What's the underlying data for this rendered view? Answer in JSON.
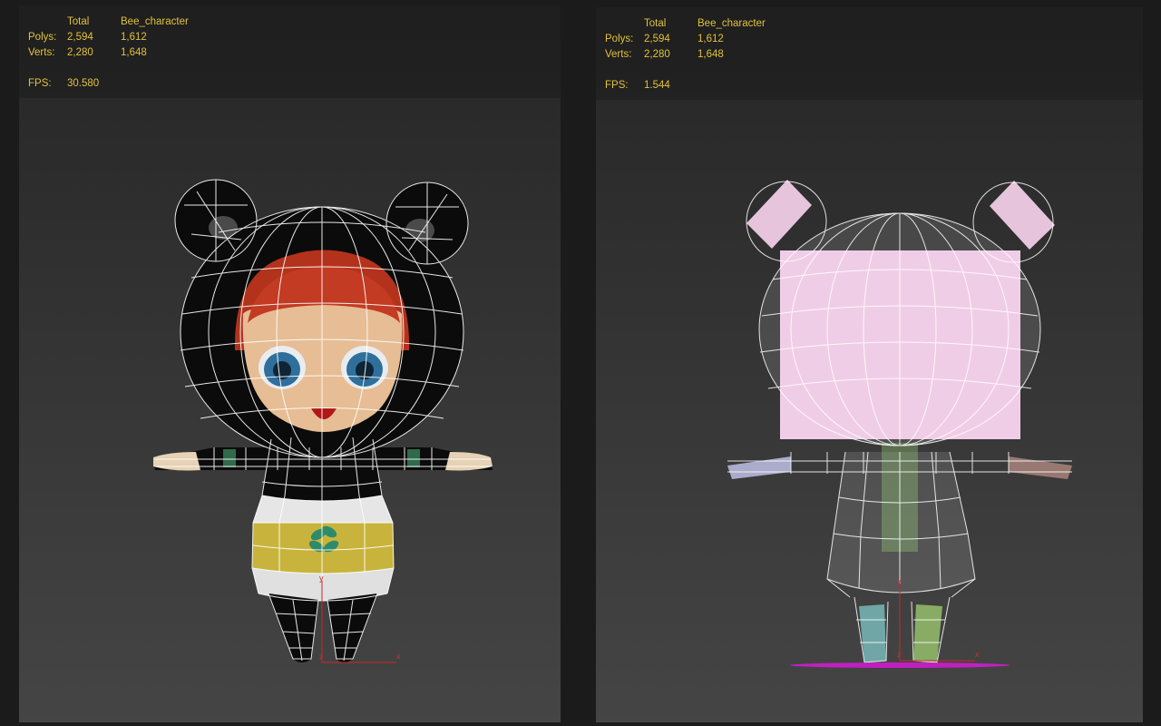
{
  "viewports": [
    {
      "stats": {
        "col_total": "Total",
        "col_object": "Bee_character",
        "polys_label": "Polys:",
        "polys_total": "2,594",
        "polys_object": "1,612",
        "verts_label": "Verts:",
        "verts_total": "2,280",
        "verts_object": "1,648",
        "fps_label": "FPS:",
        "fps_value": "30.580"
      },
      "axis": {
        "y": "y",
        "x": "x",
        "z": "z"
      }
    },
    {
      "stats": {
        "col_total": "Total",
        "col_object": "Bee_character",
        "polys_label": "Polys:",
        "polys_total": "2,594",
        "polys_object": "1,612",
        "verts_label": "Verts:",
        "verts_total": "2,280",
        "verts_object": "1,648",
        "fps_label": "FPS:",
        "fps_value": "1.544"
      },
      "axis": {
        "y": "y",
        "x": "x",
        "z": "z"
      }
    }
  ],
  "colors": {
    "stat_text": "#e0c23a",
    "hair": "#b3321c",
    "skin": "#e6bd94",
    "hood": "#0b0b0b",
    "dress": "#c8b43c",
    "leaf": "#2f8a6a",
    "proxy_pink": "#f0cde6",
    "ground_magenta": "#c020c0",
    "axis_red": "#c82828"
  },
  "icons": [
    "axis-gizmo-icon"
  ]
}
